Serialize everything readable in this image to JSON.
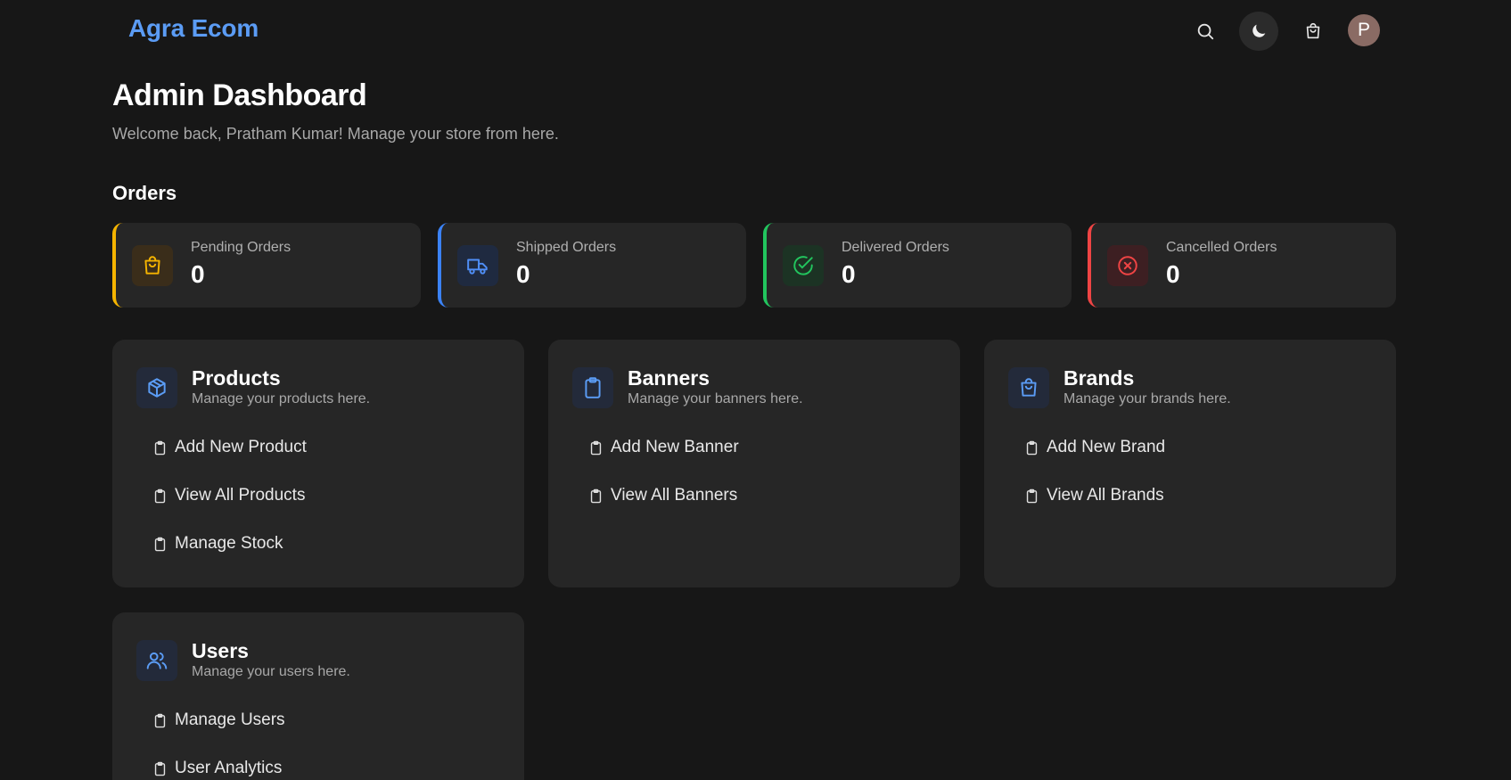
{
  "header": {
    "brand": "Agra Ecom",
    "avatar_initial": "P",
    "icons": [
      "search-icon",
      "moon-icon",
      "shopping-bag-icon"
    ]
  },
  "page": {
    "title": "Admin Dashboard",
    "subtitle": "Welcome back, Pratham Kumar! Manage your store from here."
  },
  "orders": {
    "section_title": "Orders",
    "stats": [
      {
        "label": "Pending Orders",
        "value": "0",
        "color": "#f5b400",
        "icon": "shopping-bag-icon"
      },
      {
        "label": "Shipped Orders",
        "value": "0",
        "color": "#3b82f6",
        "icon": "truck-icon"
      },
      {
        "label": "Delivered Orders",
        "value": "0",
        "color": "#22c55e",
        "icon": "check-circle-icon"
      },
      {
        "label": "Cancelled Orders",
        "value": "0",
        "color": "#ef4444",
        "icon": "x-circle-icon"
      }
    ]
  },
  "cards": {
    "products": {
      "title": "Products",
      "subtitle": "Manage your products here.",
      "links": [
        "Add New Product",
        "View All Products",
        "Manage Stock"
      ]
    },
    "banners": {
      "title": "Banners",
      "subtitle": "Manage your banners here.",
      "links": [
        "Add New Banner",
        "View All Banners"
      ]
    },
    "brands": {
      "title": "Brands",
      "subtitle": "Manage your brands here.",
      "links": [
        "Add New Brand",
        "View All Brands"
      ]
    },
    "users": {
      "title": "Users",
      "subtitle": "Manage your users here.",
      "links": [
        "Manage Users",
        "User Analytics"
      ]
    }
  },
  "colors": {
    "background": "#171717",
    "card": "#262626",
    "brand": "#5b9cf5",
    "icon_blue": "#5b9cf5"
  }
}
